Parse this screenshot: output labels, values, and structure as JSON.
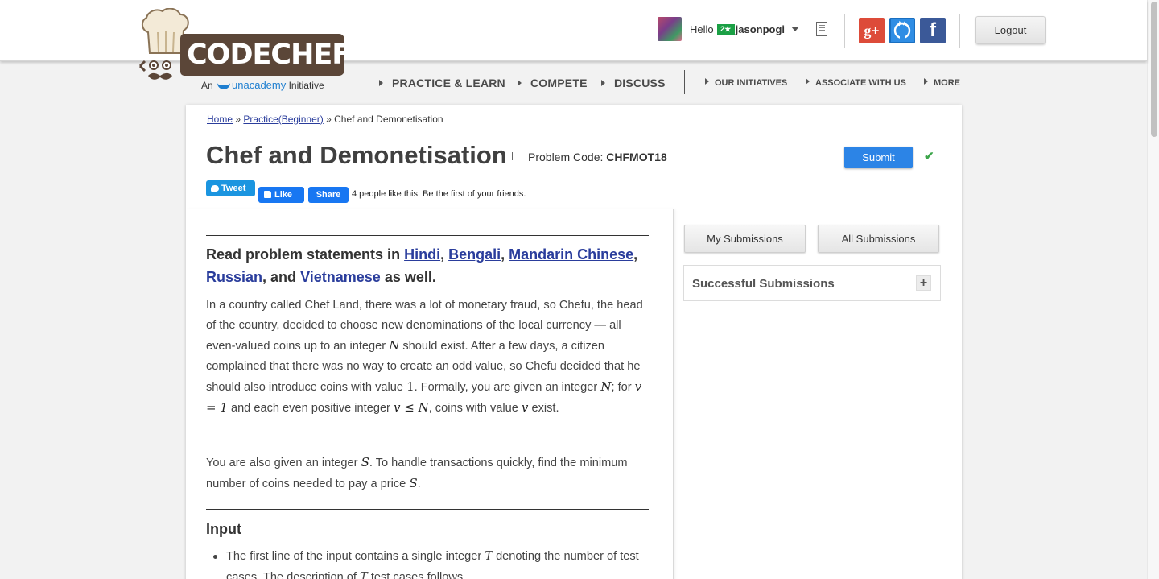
{
  "logo": {
    "wordmark": "CODECHEF",
    "tagline_prefix": "An",
    "tagline_brand": "unacademy",
    "tagline_suffix": "Initiative"
  },
  "user": {
    "greeting": "Hello",
    "flag_text": "2★",
    "username": "jasonpogi"
  },
  "social": {
    "gplus_label": "g+",
    "facebook_label": "f"
  },
  "header": {
    "logout_label": "Logout"
  },
  "nav": {
    "main": [
      "PRACTICE & LEARN",
      "COMPETE",
      "DISCUSS"
    ],
    "secondary": [
      "OUR INITIATIVES",
      "ASSOCIATE WITH US",
      "MORE"
    ]
  },
  "breadcrumb": {
    "home": "Home",
    "sep1": "»",
    "practice": "Practice(Beginner)",
    "sep2": "»",
    "current": "Chef and Demonetisation"
  },
  "problem": {
    "title": "Chef and Demonetisation",
    "code_label": "Problem Code:",
    "code": "CHFMOT18",
    "submit_label": "Submit"
  },
  "share": {
    "tweet_label": "Tweet",
    "like_label": "Like",
    "share_label": "Share",
    "like_text": "4 people like this. Be the first of your friends."
  },
  "statement": {
    "langs_prefix": "Read problem statements in",
    "langs": [
      "Hindi",
      "Bengali",
      "Mandarin Chinese",
      "Russian",
      "Vietnamese"
    ],
    "langs_and": "and",
    "langs_suffix": "as well.",
    "p1_a": "In a country called Chef Land, there was a lot of monetary fraud, so Chefu, the head of the country, decided to choose new denominations of the local currency — all even-valued coins up to an integer",
    "p1_b": "should exist. After a few days, a citizen complained that there was no way to create an odd value, so Chefu decided that he should also introduce coins with value",
    "p1_c": ". Formally, you are given an integer",
    "p1_d": "; for",
    "p1_e": "and each even positive integer",
    "p1_f": ", coins with value",
    "p1_g": "exist.",
    "p2_a": "You are also given an integer",
    "p2_b": ". To handle transactions quickly, find the minimum number of coins needed to pay a price",
    "p2_c": ".",
    "var_N": "N",
    "var_v": "v",
    "var_S": "S",
    "var_T": "T",
    "one": "1",
    "eq_v1": "v = 1",
    "leq": "v ≤ N",
    "input_heading": "Input",
    "bullet1_a": "The first line of the input contains a single integer",
    "bullet1_b": "denoting the number of test cases. The description of",
    "bullet1_c": "test cases follows."
  },
  "sidebar": {
    "my_submissions": "My Submissions",
    "all_submissions": "All Submissions",
    "successful_submissions": "Successful Submissions",
    "expand_symbol": "+"
  },
  "colors": {
    "brand_brown": "#5b4638",
    "link_blue": "#2a3d9c",
    "submit_blue": "#2c84e6",
    "check_green": "#3ca54a"
  }
}
